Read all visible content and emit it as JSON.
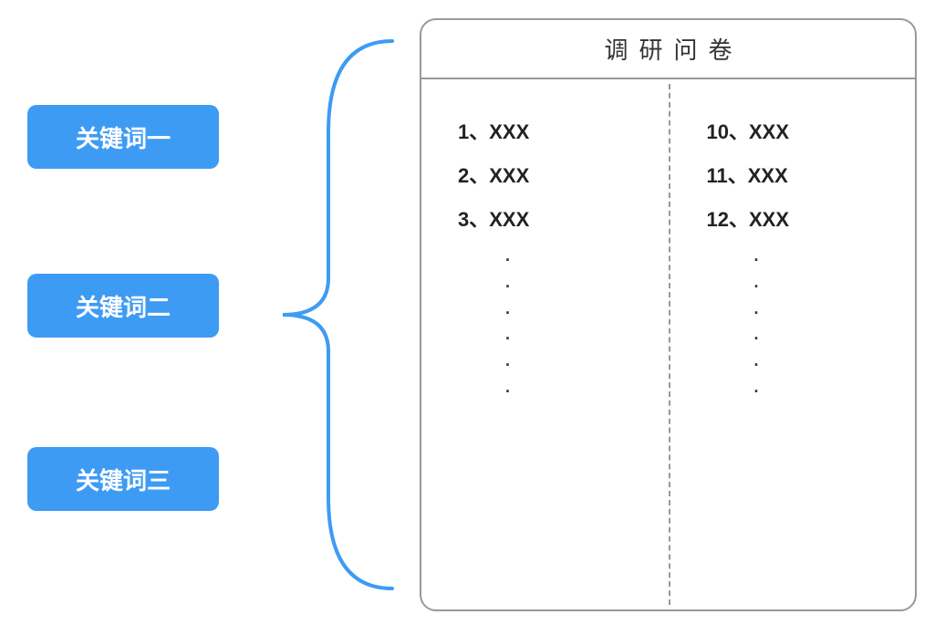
{
  "keywords": {
    "kw1": "关键词一",
    "kw2": "关键词二",
    "kw3": "关键词三"
  },
  "document": {
    "title": "调研问卷",
    "leftColumn": {
      "item1": "1、XXX",
      "item2": "2、XXX",
      "item3": "3、XXX"
    },
    "rightColumn": {
      "item1": "10、XXX",
      "item2": "11、XXX",
      "item3": "12、XXX"
    },
    "dotChar": "·"
  }
}
